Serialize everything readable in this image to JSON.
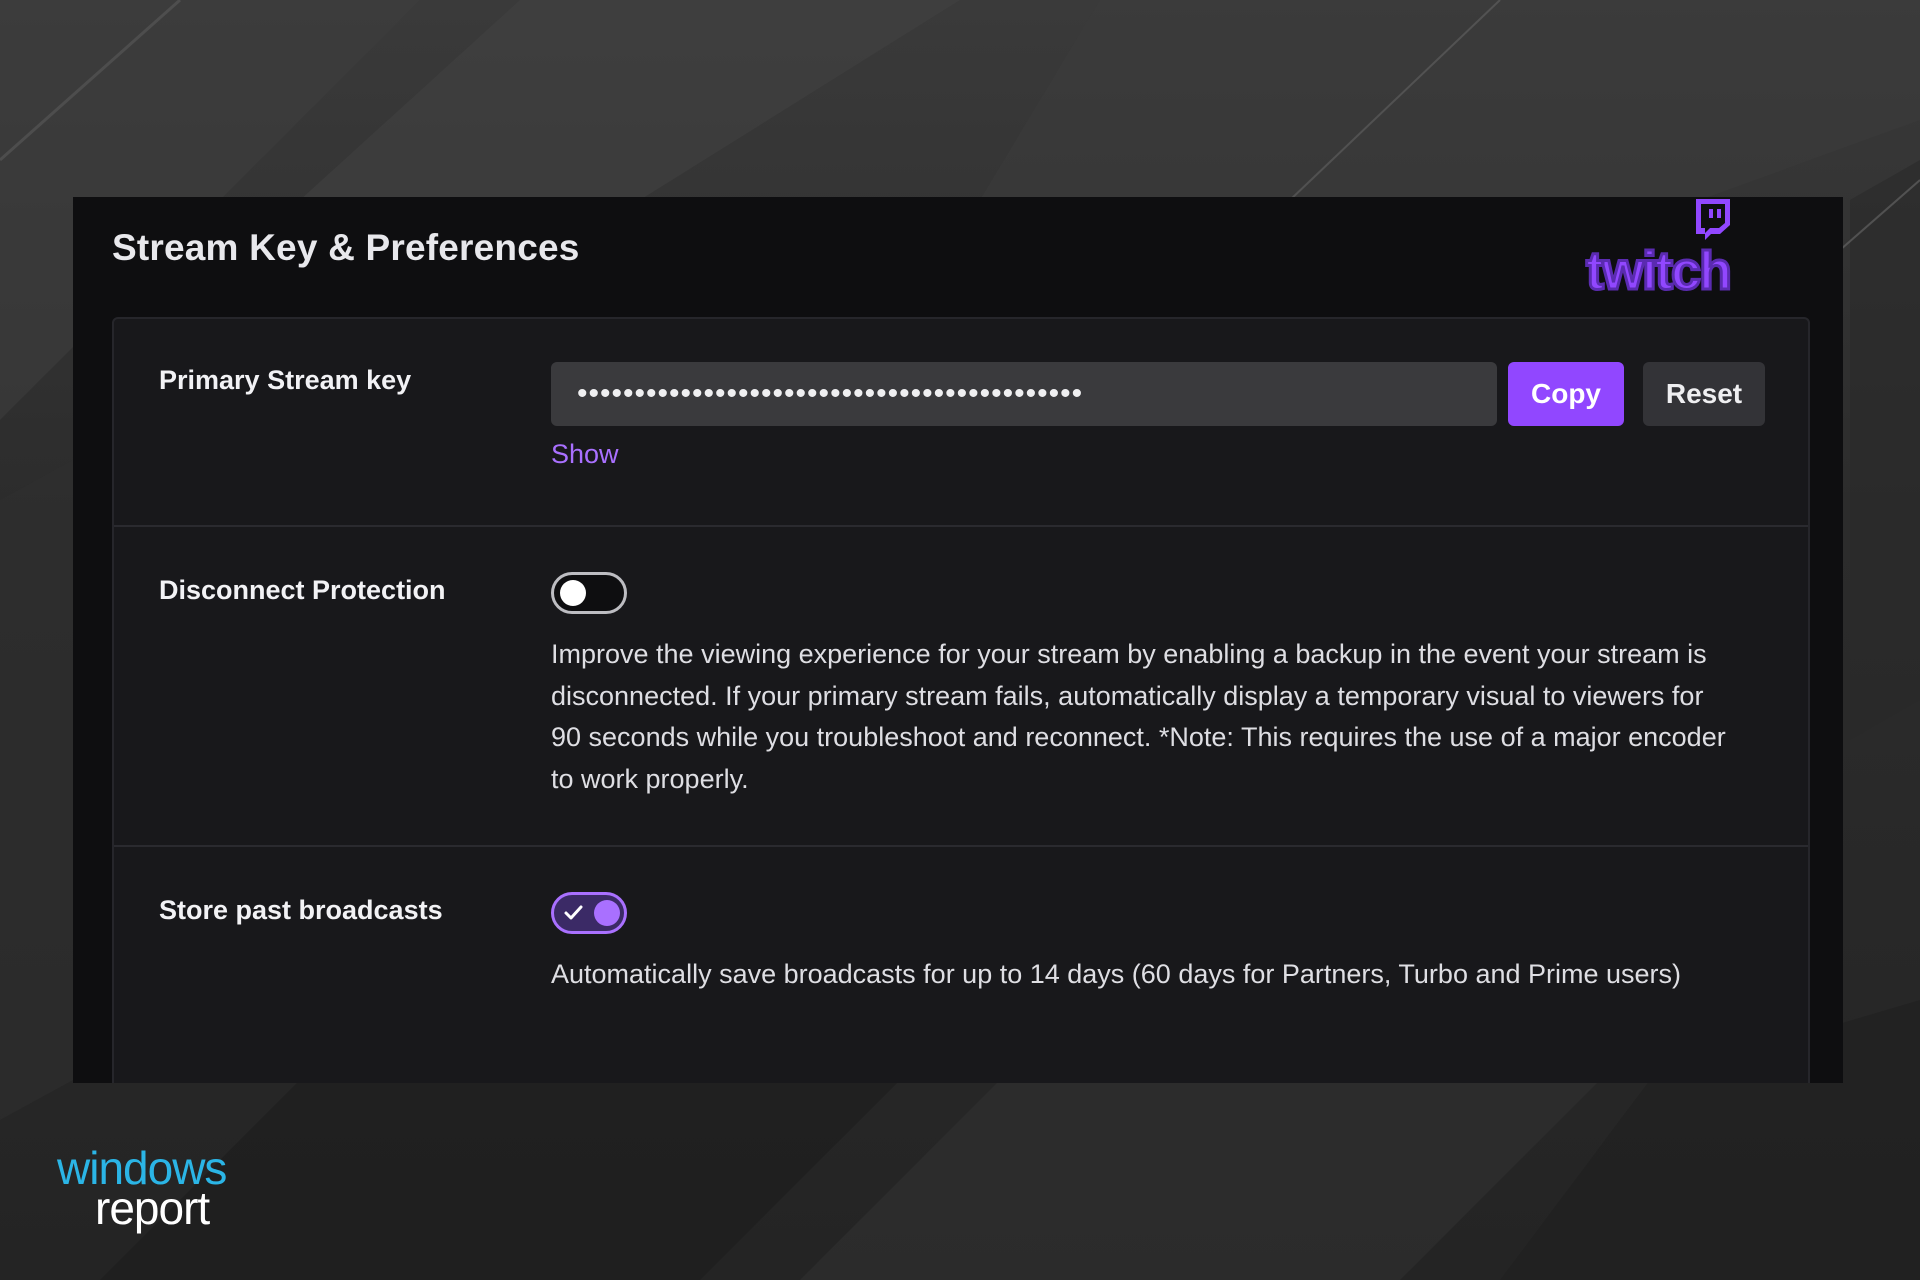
{
  "page": {
    "title": "Stream Key & Preferences",
    "brand_logo_text": "twitch",
    "accent_color": "#9147ff"
  },
  "stream_key": {
    "label": "Primary Stream key",
    "masked_value": "••••••••••••••••••••••••••••••••••••••••••••",
    "copy_label": "Copy",
    "reset_label": "Reset",
    "show_label": "Show"
  },
  "disconnect_protection": {
    "label": "Disconnect Protection",
    "enabled": false,
    "description": "Improve the viewing experience for your stream by enabling a backup in the event your stream is disconnected. If your primary stream fails, automatically display a temporary visual to viewers for 90 seconds while you troubleshoot and reconnect. *Note: This requires the use of a major encoder to work properly."
  },
  "store_past_broadcasts": {
    "label": "Store past broadcasts",
    "enabled": true,
    "description": "Automatically save broadcasts for up to 14 days (60 days for Partners, Turbo and Prime users)"
  },
  "watermark": {
    "line1": "windows",
    "line2": "report"
  }
}
